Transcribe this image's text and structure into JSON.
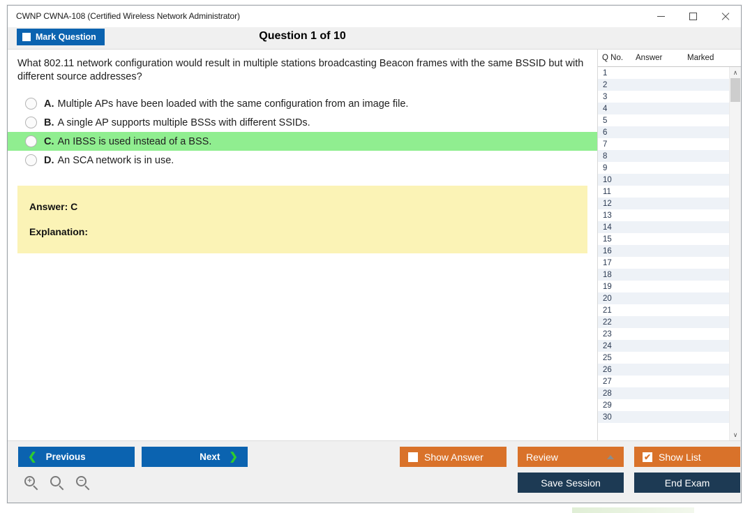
{
  "window": {
    "title": "CWNP CWNA-108 (Certified Wireless Network Administrator)",
    "controls": {
      "minimize": "minimize-icon",
      "maximize": "maximize-icon",
      "close": "close-icon"
    }
  },
  "header": {
    "mark_question_label": "Mark Question",
    "mark_question_checked": false,
    "question_counter": "Question 1 of 10"
  },
  "question": {
    "text": "What 802.11 network configuration would result in multiple stations broadcasting Beacon frames with the same BSSID but with different source addresses?",
    "options": [
      {
        "letter": "A.",
        "text": "Multiple APs have been loaded with the same configuration from an image file.",
        "selected": false
      },
      {
        "letter": "B.",
        "text": "A single AP supports multiple BSSs with different SSIDs.",
        "selected": false
      },
      {
        "letter": "C.",
        "text": "An IBSS is used instead of a BSS.",
        "selected": true
      },
      {
        "letter": "D.",
        "text": "An SCA network is in use.",
        "selected": false
      }
    ]
  },
  "answer_panel": {
    "answer_label": "Answer: C",
    "explanation_label": "Explanation:"
  },
  "question_list": {
    "columns": [
      "Q No.",
      "Answer",
      "Marked"
    ],
    "rows": [
      {
        "qno": "1",
        "answer": "",
        "marked": ""
      },
      {
        "qno": "2",
        "answer": "",
        "marked": ""
      },
      {
        "qno": "3",
        "answer": "",
        "marked": ""
      },
      {
        "qno": "4",
        "answer": "",
        "marked": ""
      },
      {
        "qno": "5",
        "answer": "",
        "marked": ""
      },
      {
        "qno": "6",
        "answer": "",
        "marked": ""
      },
      {
        "qno": "7",
        "answer": "",
        "marked": ""
      },
      {
        "qno": "8",
        "answer": "",
        "marked": ""
      },
      {
        "qno": "9",
        "answer": "",
        "marked": ""
      },
      {
        "qno": "10",
        "answer": "",
        "marked": ""
      },
      {
        "qno": "11",
        "answer": "",
        "marked": ""
      },
      {
        "qno": "12",
        "answer": "",
        "marked": ""
      },
      {
        "qno": "13",
        "answer": "",
        "marked": ""
      },
      {
        "qno": "14",
        "answer": "",
        "marked": ""
      },
      {
        "qno": "15",
        "answer": "",
        "marked": ""
      },
      {
        "qno": "16",
        "answer": "",
        "marked": ""
      },
      {
        "qno": "17",
        "answer": "",
        "marked": ""
      },
      {
        "qno": "18",
        "answer": "",
        "marked": ""
      },
      {
        "qno": "19",
        "answer": "",
        "marked": ""
      },
      {
        "qno": "20",
        "answer": "",
        "marked": ""
      },
      {
        "qno": "21",
        "answer": "",
        "marked": ""
      },
      {
        "qno": "22",
        "answer": "",
        "marked": ""
      },
      {
        "qno": "23",
        "answer": "",
        "marked": ""
      },
      {
        "qno": "24",
        "answer": "",
        "marked": ""
      },
      {
        "qno": "25",
        "answer": "",
        "marked": ""
      },
      {
        "qno": "26",
        "answer": "",
        "marked": ""
      },
      {
        "qno": "27",
        "answer": "",
        "marked": ""
      },
      {
        "qno": "28",
        "answer": "",
        "marked": ""
      },
      {
        "qno": "29",
        "answer": "",
        "marked": ""
      },
      {
        "qno": "30",
        "answer": "",
        "marked": ""
      }
    ],
    "scroll_up_glyph": "∧",
    "scroll_down_glyph": "∨"
  },
  "footer": {
    "previous_label": "Previous",
    "next_label": "Next",
    "prev_chevron": "❮",
    "next_chevron": "❯",
    "show_answer_label": "Show Answer",
    "show_answer_checked": false,
    "review_label": "Review",
    "show_list_label": "Show List",
    "show_list_checked": true,
    "check_glyph": "✔",
    "save_session_label": "Save Session",
    "end_exam_label": "End Exam",
    "zoom_in_icon": "zoom-in-icon",
    "zoom_reset_icon": "zoom-reset-icon",
    "zoom_out_icon": "zoom-out-icon",
    "zoom_in_sign": "+",
    "zoom_out_sign": "−"
  },
  "colors": {
    "primary_blue": "#0b63b0",
    "orange": "#d9722a",
    "navy": "#1d3a54",
    "selected_green": "#90ee90",
    "answer_yellow": "#fbf3b6",
    "chevron_green": "#2ecc2e"
  }
}
